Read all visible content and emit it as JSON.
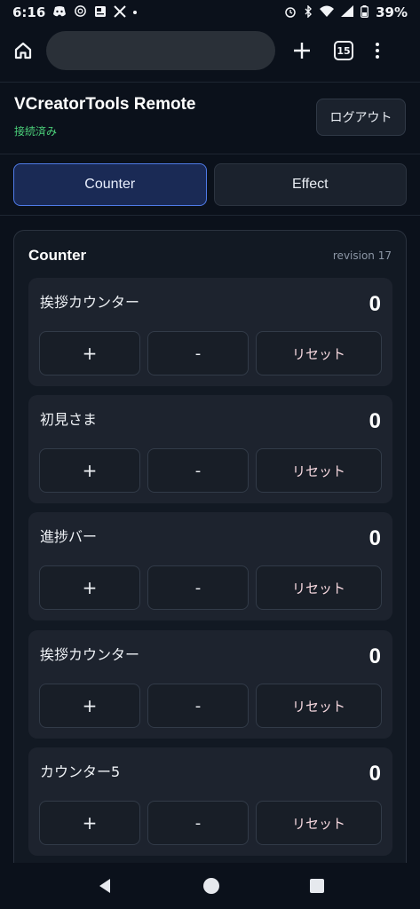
{
  "status_bar": {
    "time": "6:16",
    "battery": "39%",
    "left_icons": [
      "discord-icon",
      "chatgpt-icon",
      "news-icon",
      "x-icon"
    ],
    "right_icons": [
      "alarm-icon",
      "bluetooth-icon",
      "wifi-icon",
      "signal-icon",
      "battery-icon"
    ]
  },
  "browser": {
    "tab_count": "15"
  },
  "header": {
    "title": "VCreatorTools Remote",
    "connection_status": "接続済み",
    "logout_label": "ログアウト"
  },
  "tabs": [
    {
      "label": "Counter",
      "active": true
    },
    {
      "label": "Effect",
      "active": false
    }
  ],
  "panel": {
    "title": "Counter",
    "revision": "revision 17"
  },
  "counters": [
    {
      "name": "挨拶カウンター",
      "value": "0"
    },
    {
      "name": "初見さま",
      "value": "0"
    },
    {
      "name": "進捗バー",
      "value": "0"
    },
    {
      "name": "挨拶カウンター",
      "value": "0"
    },
    {
      "name": "カウンター5",
      "value": "0"
    }
  ],
  "buttons": {
    "plus": "+",
    "minus": "-",
    "reset": "リセット"
  },
  "colors": {
    "background": "#0b111b",
    "accent": "#4f7be8",
    "connected": "#4cd17a"
  }
}
